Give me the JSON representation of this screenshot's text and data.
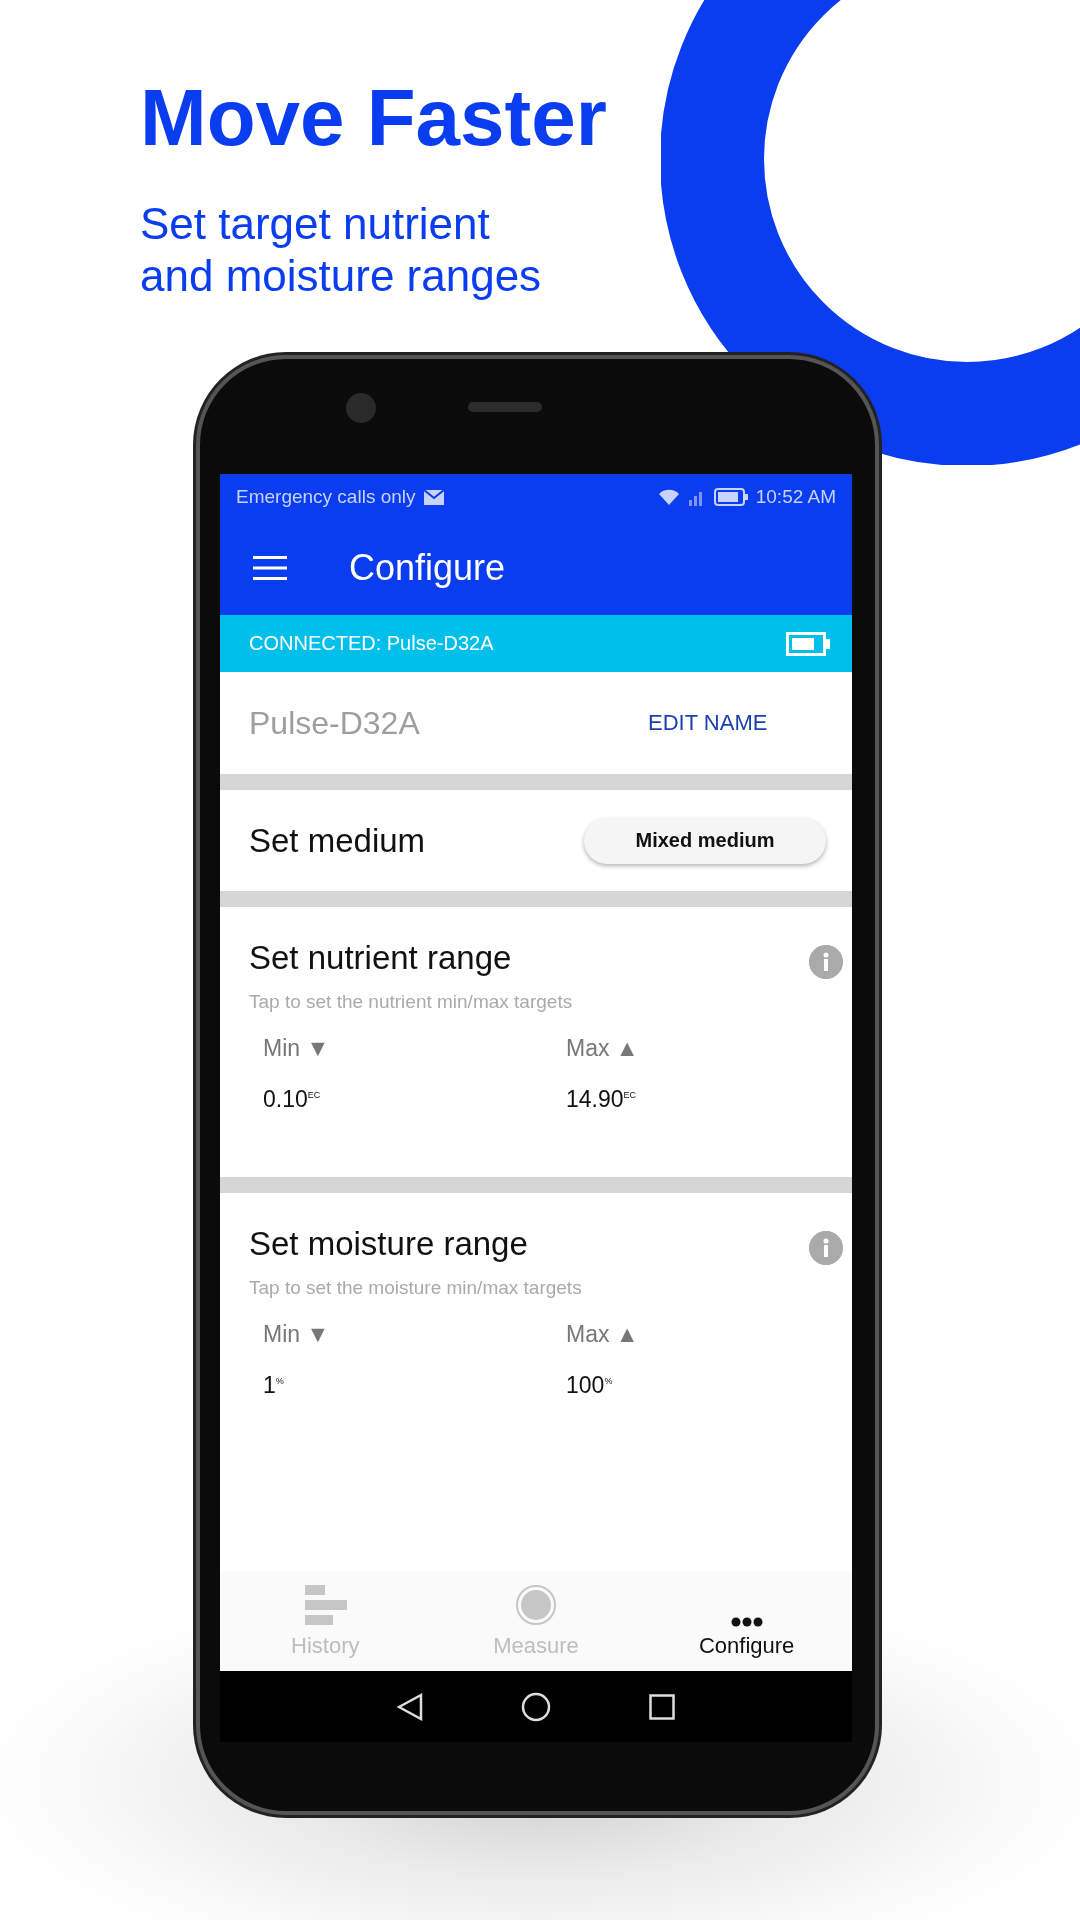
{
  "headline": "Move Faster",
  "subheadline": [
    "Set target nutrient",
    "and moisture ranges"
  ],
  "status_bar": {
    "carrier": "Emergency calls only",
    "time": "10:52 AM"
  },
  "app_bar": {
    "title": "Configure"
  },
  "connection": {
    "text": "CONNECTED: Pulse-D32A"
  },
  "device": {
    "name": "Pulse-D32A",
    "action": "EDIT NAME"
  },
  "medium": {
    "label": "Set medium",
    "value": "Mixed medium"
  },
  "ranges": [
    {
      "title": "Set nutrient range",
      "hint": "Tap to set the nutrient min/max targets",
      "min_label": "Min ▼",
      "max_label": "Max ▲",
      "min_value": "0.10$^{EC}$",
      "max_value": "14.90$^{EC}$"
    },
    {
      "title": "Set moisture range",
      "hint": "Tap to set the moisture min/max targets",
      "min_label": "Min ▼",
      "max_label": "Max ▲",
      "min_value": "1$^{%}$",
      "max_value": "100$^{%}$"
    }
  ],
  "nav": [
    {
      "label": "History",
      "kind": "history",
      "selected": false
    },
    {
      "label": "Measure",
      "kind": "measure",
      "selected": false
    },
    {
      "label": "Configure",
      "kind": "more",
      "selected": true
    }
  ]
}
